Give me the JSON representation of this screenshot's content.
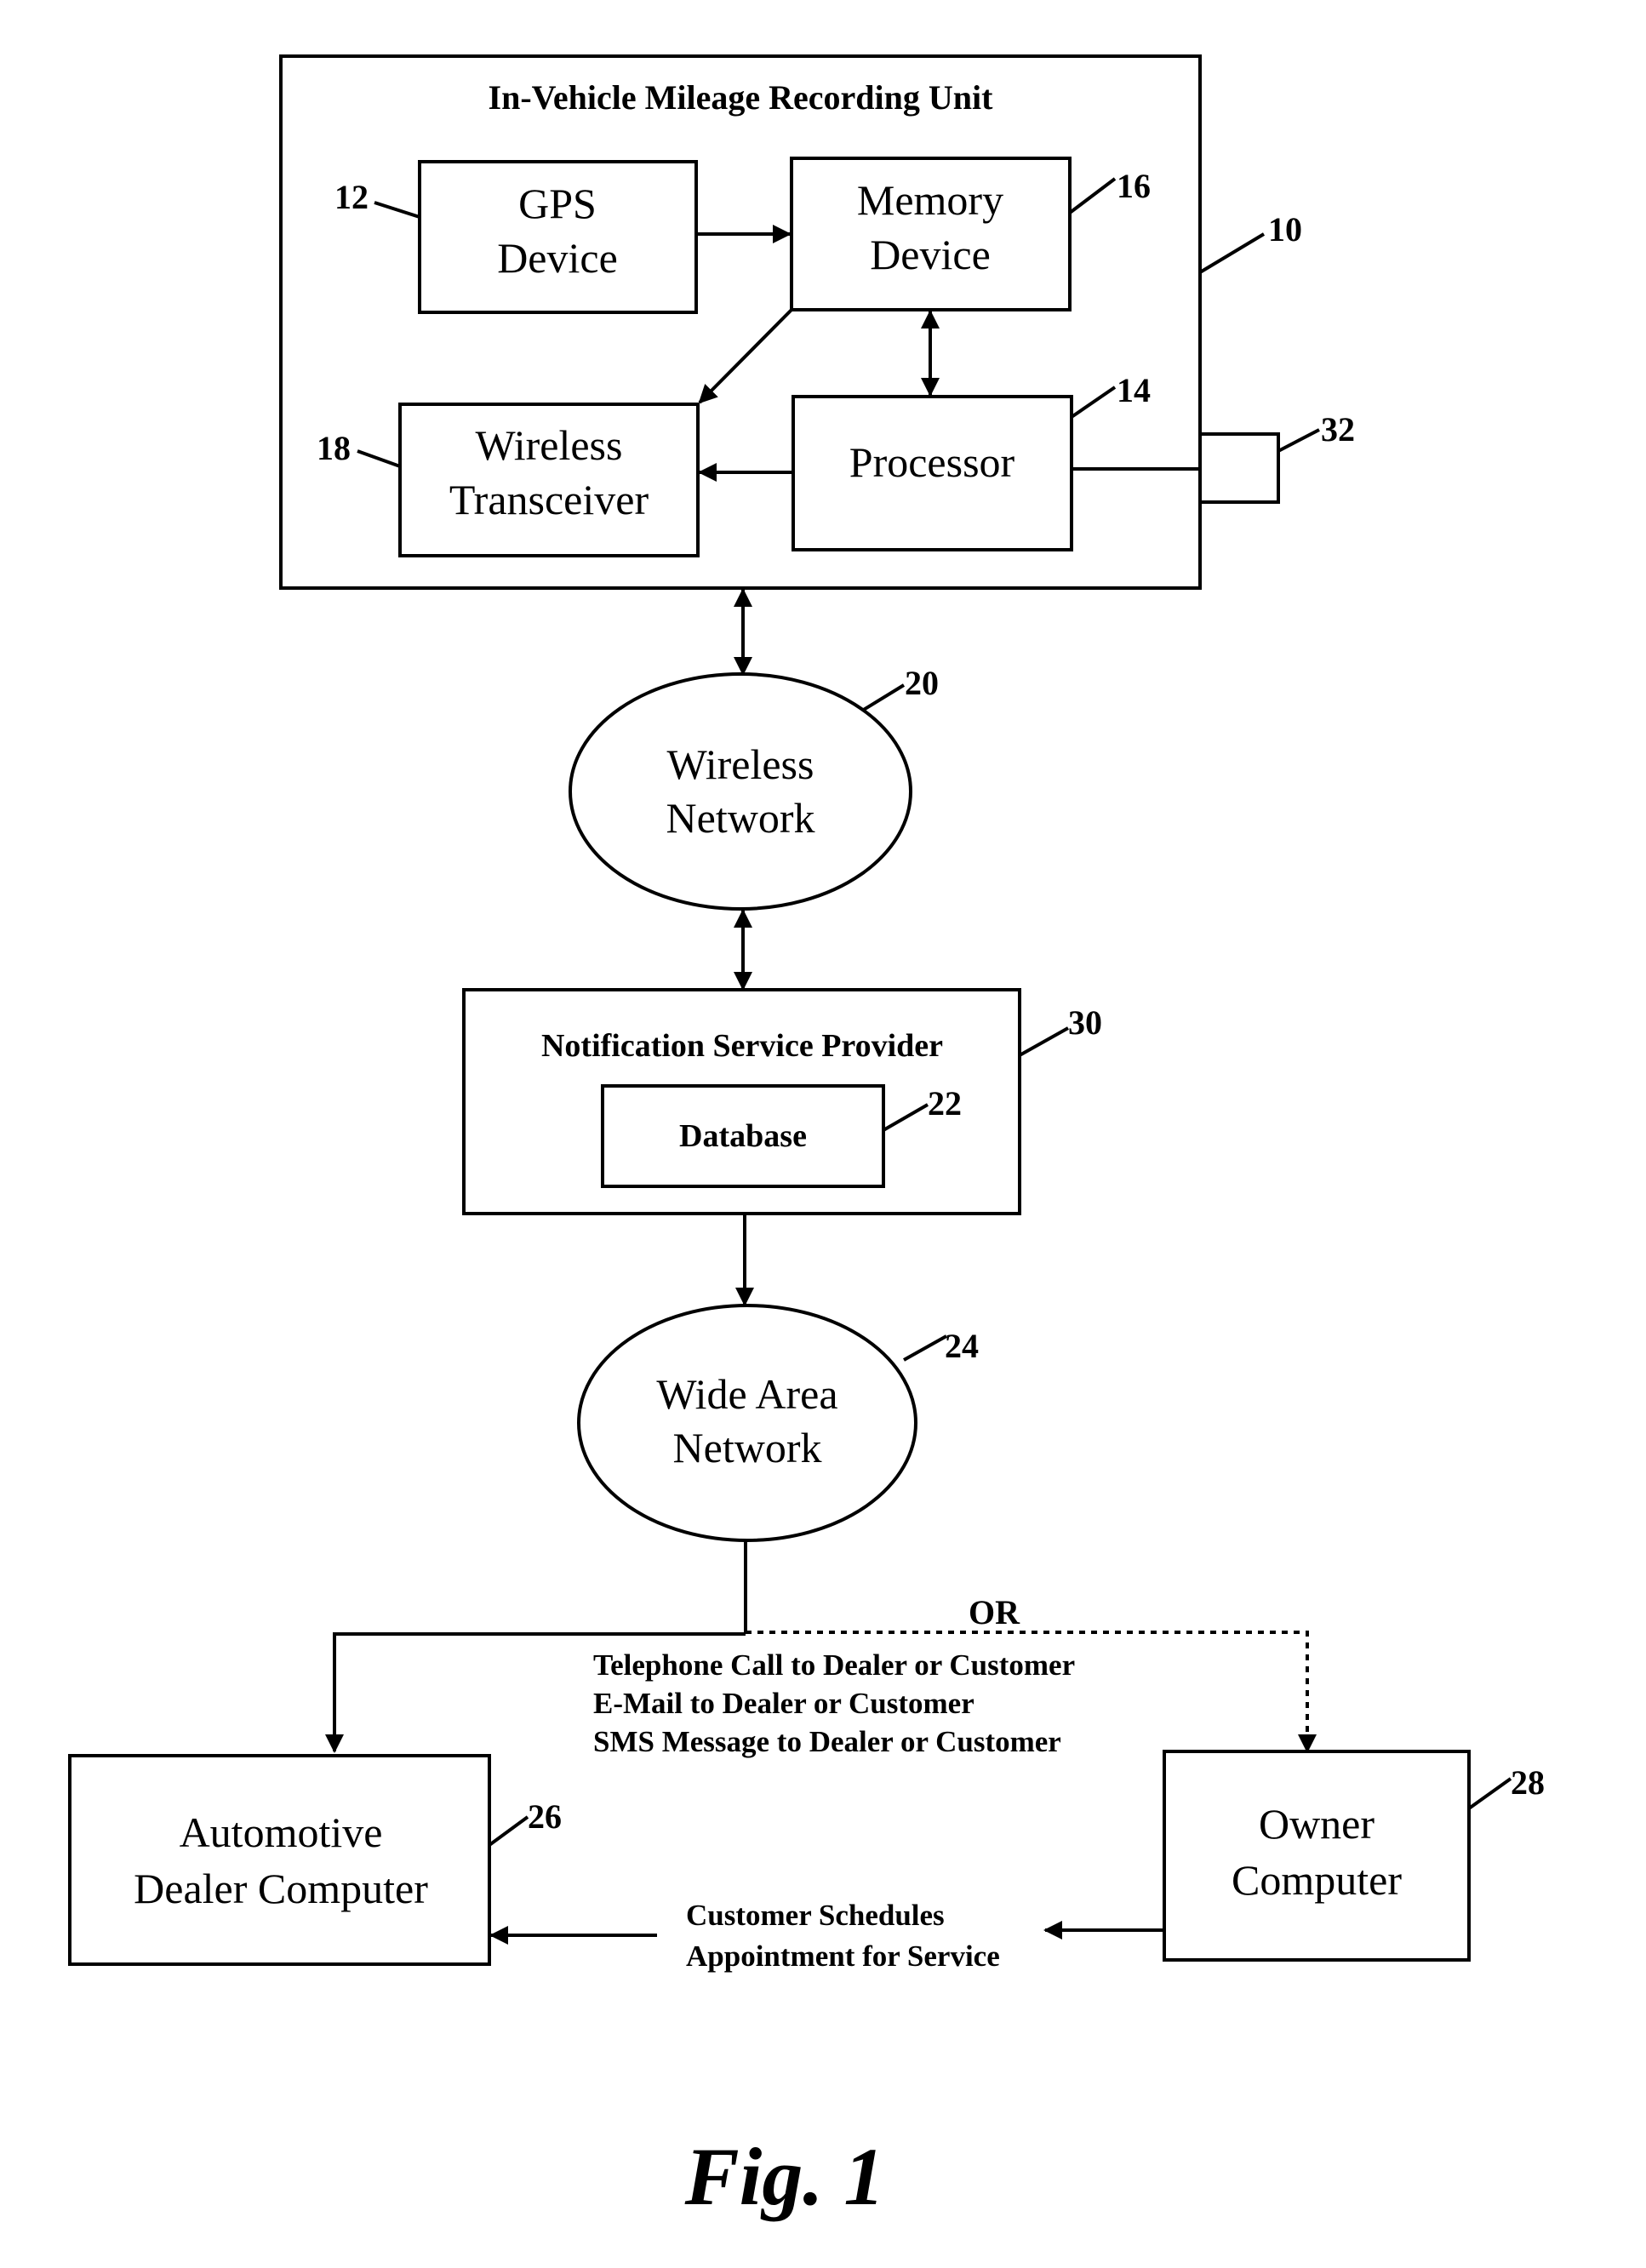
{
  "figure_label": "Fig. 1",
  "unit": {
    "title": "In-Vehicle Mileage Recording Unit",
    "ref": "10",
    "gps": {
      "line1": "GPS",
      "line2": "Device",
      "ref": "12"
    },
    "memory": {
      "line1": "Memory",
      "line2": "Device",
      "ref": "16"
    },
    "processor": {
      "label": "Processor",
      "ref": "14"
    },
    "transceiver": {
      "line1": "Wireless",
      "line2": "Transceiver",
      "ref": "18"
    },
    "port_ref": "32"
  },
  "wireless_network": {
    "line1": "Wireless",
    "line2": "Network",
    "ref": "20"
  },
  "provider": {
    "title": "Notification Service Provider",
    "ref": "30",
    "database": {
      "label": "Database",
      "ref": "22"
    }
  },
  "wan": {
    "line1": "Wide Area",
    "line2": "Network",
    "ref": "24"
  },
  "branch": {
    "or_label": "OR",
    "notifications": [
      "Telephone Call to Dealer or Customer",
      "E-Mail to Dealer or Customer",
      "SMS Message to Dealer or Customer"
    ]
  },
  "dealer": {
    "line1": "Automotive",
    "line2": "Dealer Computer",
    "ref": "26"
  },
  "owner": {
    "line1": "Owner",
    "line2": "Computer",
    "ref": "28"
  },
  "schedule": {
    "line1": "Customer Schedules",
    "line2": "Appointment for Service"
  }
}
